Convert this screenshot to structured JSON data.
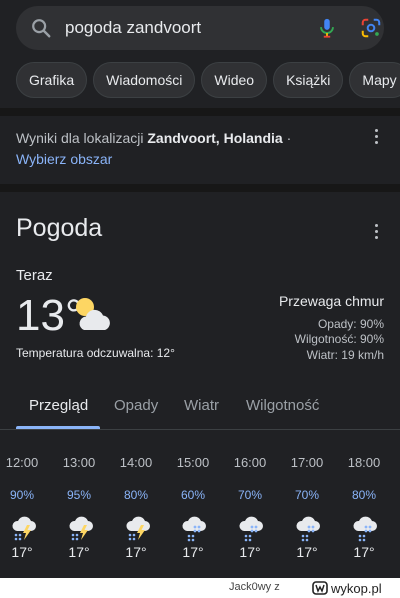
{
  "search": {
    "query": "pogoda zandvoort",
    "search_icon": "search-icon",
    "mic_icon": "microphone-icon",
    "lens_icon": "google-lens-icon"
  },
  "chips": [
    "Grafika",
    "Wiadomości",
    "Wideo",
    "Książki",
    "Mapy"
  ],
  "location": {
    "prefix": "Wyniki dla lokalizacji ",
    "place": "Zandvoort, Holandia",
    "suffix": " ·",
    "change_link": "Wybierz obszar"
  },
  "weather": {
    "title": "Pogoda",
    "now_label": "Teraz",
    "temperature": "13°",
    "feels_like": "Temperatura odczuwalna: 12°",
    "condition": "Przewaga chmur",
    "precipitation": "Opady: 90%",
    "humidity": "Wilgotność: 90%",
    "wind": "Wiatr: 19 km/h",
    "current_icon": "partly-cloudy-icon",
    "tabs": [
      "Przegląd",
      "Opady",
      "Wiatr",
      "Wilgotność"
    ],
    "active_tab": "Przegląd",
    "hourly": [
      {
        "time": "12:00",
        "precip": "90%",
        "temp": "17°",
        "icon": "thunderstorm-rain-icon"
      },
      {
        "time": "13:00",
        "precip": "95%",
        "temp": "17°",
        "icon": "thunderstorm-rain-icon"
      },
      {
        "time": "14:00",
        "precip": "80%",
        "temp": "17°",
        "icon": "thunderstorm-rain-icon"
      },
      {
        "time": "15:00",
        "precip": "60%",
        "temp": "17°",
        "icon": "showers-icon"
      },
      {
        "time": "16:00",
        "precip": "70%",
        "temp": "17°",
        "icon": "showers-icon"
      },
      {
        "time": "17:00",
        "precip": "70%",
        "temp": "17°",
        "icon": "showers-icon"
      },
      {
        "time": "18:00",
        "precip": "80%",
        "temp": "17°",
        "icon": "showers-icon"
      }
    ]
  },
  "footer": {
    "username": "Jack0wy",
    "separator": "z",
    "site": "wykop.pl"
  },
  "colors": {
    "background": "#202124",
    "surface": "#303134",
    "accent_blue": "#8ab4f8",
    "sun": "#fdd663",
    "lightning": "#fdd663"
  }
}
